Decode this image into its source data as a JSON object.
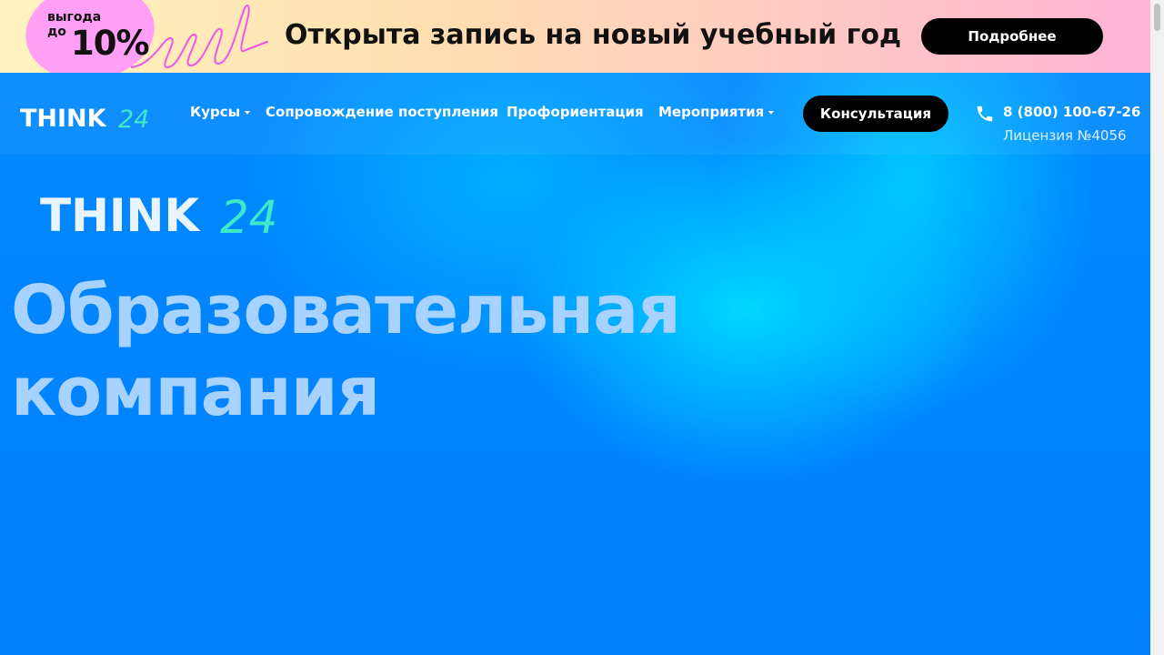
{
  "promo": {
    "discount_prefix_line1": "выгода",
    "discount_prefix_line2": "до",
    "discount_value": "10%",
    "title": "Открыта запись на новый учебный год",
    "button_label": "Подробнее",
    "colors": {
      "blob": "#ff9ff5",
      "button": "#000000"
    }
  },
  "header": {
    "logo_text": "THINK",
    "logo_suffix": "24",
    "nav": [
      {
        "label": "Курсы",
        "has_dropdown": true,
        "icon": "chevron-down-icon"
      },
      {
        "label": "Сопровождение поступления",
        "has_dropdown": false
      },
      {
        "label": "Профориентация",
        "has_dropdown": false
      },
      {
        "label": "Мероприятия",
        "has_dropdown": true,
        "icon": "chevron-down-icon"
      }
    ],
    "consult_button": "Консультация",
    "phone_icon": "phone-icon",
    "phone": "8 (800) 100-67-26",
    "license": "Лицензия №4056"
  },
  "hero": {
    "logo_text": "THINK",
    "logo_suffix": "24",
    "title_line1": "Образовательная",
    "title_line2": "компания"
  },
  "colors": {
    "accent_blue": "#0080ff",
    "glow_cyan": "#00d4ff",
    "logo_teal": "#3ee8c8",
    "hero_title": "#a8d2ff"
  }
}
